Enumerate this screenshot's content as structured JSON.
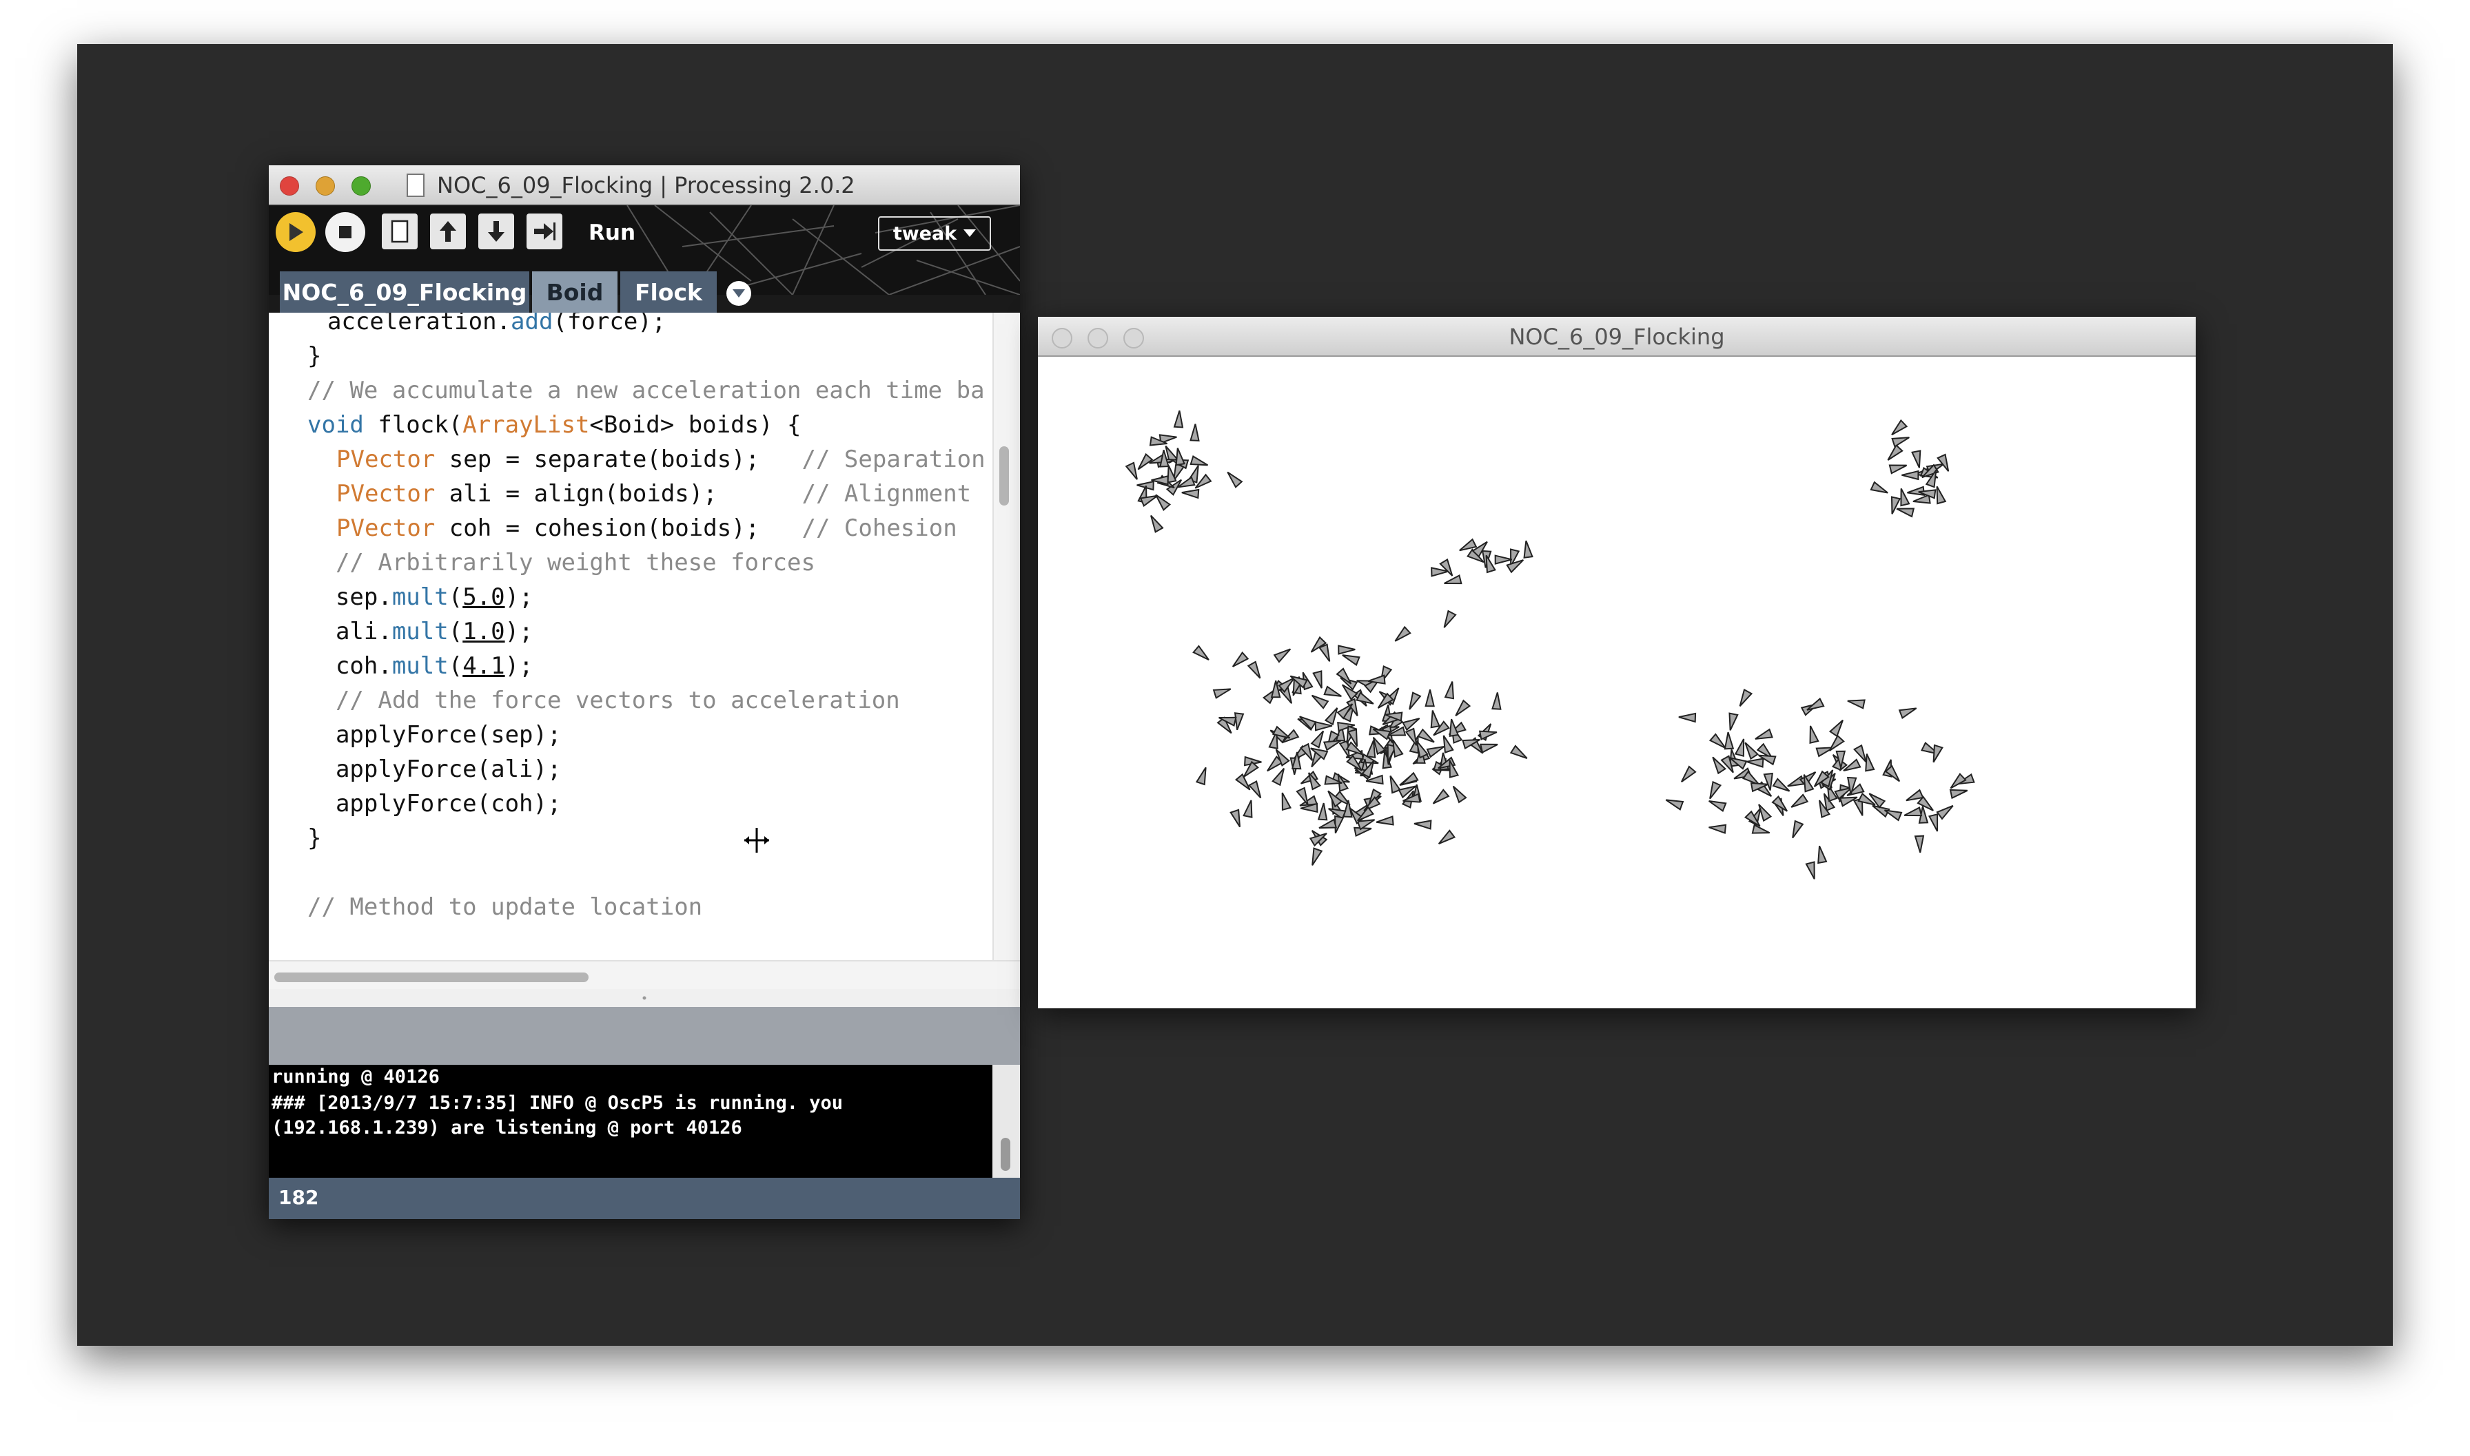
{
  "ide": {
    "title": "NOC_6_09_Flocking | Processing 2.0.2",
    "toolbar": {
      "run_label": "Run",
      "mode_label": "tweak",
      "buttons": [
        "play-icon",
        "stop-icon",
        "new-icon",
        "open-icon",
        "save-icon",
        "export-icon"
      ]
    },
    "tabs": [
      {
        "label": "NOC_6_09_Flocking"
      },
      {
        "label": "Boid"
      },
      {
        "label": "Flock"
      }
    ],
    "code": {
      "l01_a": "  acceleration.",
      "l01_b": "add",
      "l01_c": "(force);",
      "l02": "}",
      "l03": "",
      "l04": "// We accumulate a new acceleration each time ba",
      "l05_kw": "void",
      "l05_b": " flock(",
      "l05_ty": "ArrayList",
      "l05_c": "<Boid> boids) {",
      "l06_ty": "PVector",
      "l06_b": " sep = separate(boids);   ",
      "l06_cm": "// Separation",
      "l07_ty": "PVector",
      "l07_b": " ali = align(boids);      ",
      "l07_cm": "// Alignment",
      "l08_ty": "PVector",
      "l08_b": " coh = cohesion(boids);   ",
      "l08_cm": "// Cohesion",
      "l09_cm": "  // Arbitrarily weight these forces",
      "l10_a": "  sep.",
      "l10_kw": "mult",
      "l10_b": "(",
      "l10_num": "5.0",
      "l10_c": ");",
      "l11_a": "  ali.",
      "l11_kw": "mult",
      "l11_b": "(",
      "l11_num": "1.0",
      "l11_c": ");",
      "l12_a": "  coh.",
      "l12_kw": "mult",
      "l12_b": "(",
      "l12_num": "4.1",
      "l12_c": ");",
      "l13_cm": "  // Add the force vectors to acceleration",
      "l14": "  applyForce(sep);",
      "l15": "  applyForce(ali);",
      "l16": "  applyForce(coh);",
      "l17": "}",
      "l18": "",
      "l19_cm": "// Method to update location"
    },
    "console": {
      "line1": "running @ 40126",
      "line2": "### [2013/9/7 15:7:35] INFO @ OscP5 is running. you",
      "line3": "(192.168.1.239) are listening @ port 40126"
    },
    "status": {
      "line_number": "182"
    }
  },
  "sketch": {
    "title": "NOC_6_09_Flocking"
  }
}
